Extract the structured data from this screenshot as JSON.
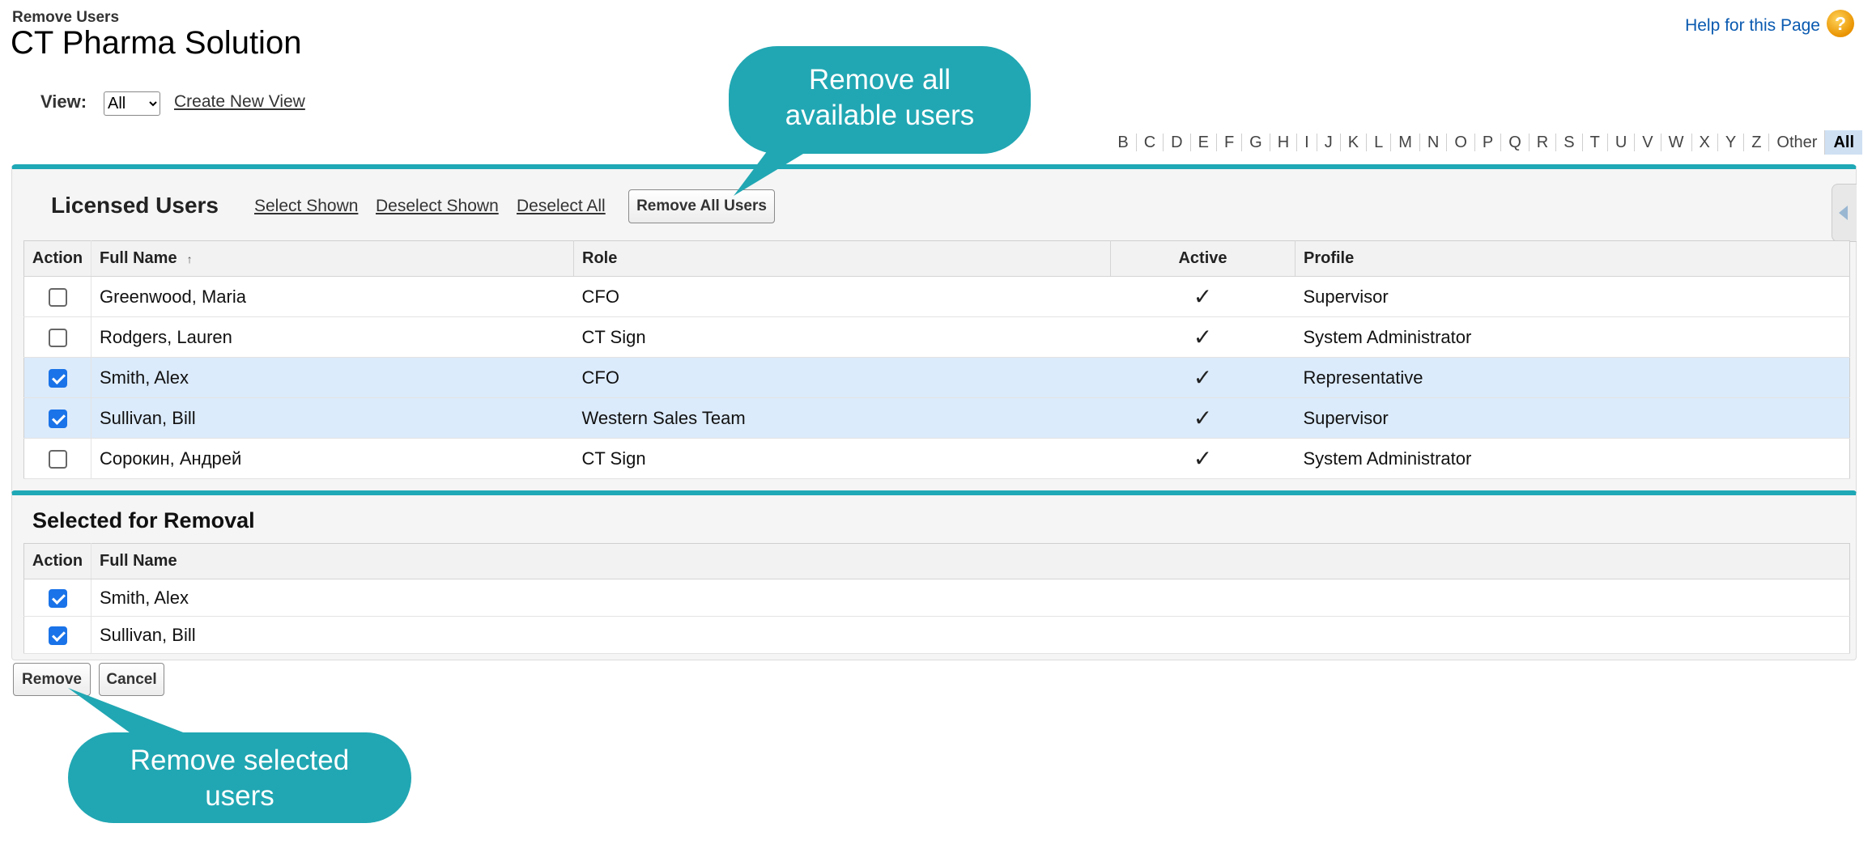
{
  "header": {
    "breadcrumb": "Remove Users",
    "title": "CT Pharma Solution",
    "help_link": "Help for this Page",
    "help_icon": "question-icon"
  },
  "view": {
    "label": "View:",
    "selected": "All",
    "options": [
      "All"
    ],
    "create_link": "Create New View"
  },
  "alphabet": {
    "letters": [
      "B",
      "C",
      "D",
      "E",
      "F",
      "G",
      "H",
      "I",
      "J",
      "K",
      "L",
      "M",
      "N",
      "O",
      "P",
      "Q",
      "R",
      "S",
      "T",
      "U",
      "V",
      "W",
      "X",
      "Y",
      "Z",
      "Other",
      "All"
    ],
    "active": "All"
  },
  "licensed": {
    "title": "Licensed Users",
    "select_shown": "Select Shown",
    "deselect_shown": "Deselect Shown",
    "deselect_all": "Deselect All",
    "remove_all_button": "Remove All Users",
    "columns": {
      "action": "Action",
      "full_name": "Full Name",
      "role": "Role",
      "active": "Active",
      "profile": "Profile"
    },
    "rows": [
      {
        "selected": false,
        "name": "Greenwood, Maria",
        "role": "CFO",
        "active": true,
        "profile": "Supervisor"
      },
      {
        "selected": false,
        "name": "Rodgers, Lauren",
        "role": "CT Sign",
        "active": true,
        "profile": "System Administrator"
      },
      {
        "selected": true,
        "name": "Smith, Alex",
        "role": "CFO",
        "active": true,
        "profile": "Representative"
      },
      {
        "selected": true,
        "name": "Sullivan, Bill",
        "role": "Western Sales Team",
        "active": true,
        "profile": "Supervisor"
      },
      {
        "selected": false,
        "name": "Сорокин, Андрей",
        "role": "CT Sign",
        "active": true,
        "profile": "System Administrator"
      }
    ]
  },
  "removal": {
    "title": "Selected for Removal",
    "columns": {
      "action": "Action",
      "full_name": "Full Name"
    },
    "rows": [
      {
        "selected": true,
        "name": "Smith, Alex"
      },
      {
        "selected": true,
        "name": "Sullivan, Bill"
      }
    ]
  },
  "footer": {
    "remove_button": "Remove",
    "cancel_button": "Cancel"
  },
  "callouts": {
    "top": [
      "Remove all",
      "available users"
    ],
    "bottom": [
      "Remove selected",
      "users"
    ]
  },
  "colors": {
    "accent_teal": "#1fa8b6",
    "callout": "#21a7b3",
    "selected_row": "#dcebfb",
    "checkbox_on": "#1a73e8",
    "link_blue": "#0a5ab0"
  }
}
